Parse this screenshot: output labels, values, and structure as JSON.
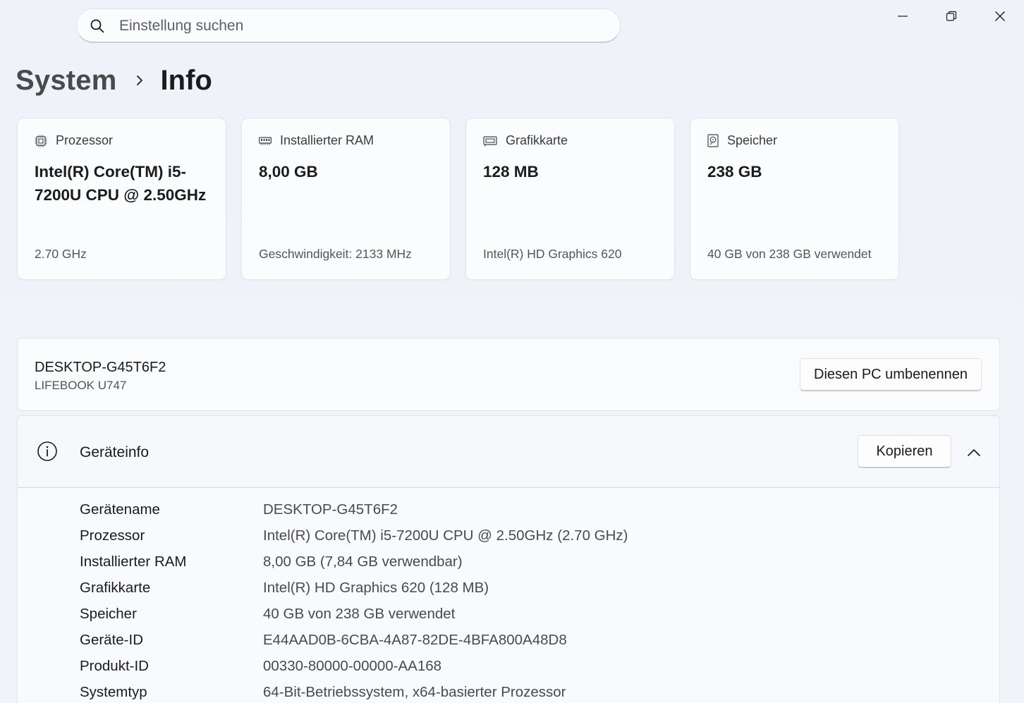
{
  "search": {
    "placeholder": "Einstellung suchen"
  },
  "window_controls": {
    "minimize": "minimize-icon",
    "maximize": "restore-icon",
    "close": "close-icon"
  },
  "breadcrumb": {
    "parent": "System",
    "current": "Info"
  },
  "cards": [
    {
      "icon": "processor-icon",
      "label": "Prozessor",
      "value": "Intel(R) Core(TM) i5-7200U CPU @ 2.50GHz",
      "sub": "2.70 GHz"
    },
    {
      "icon": "ram-icon",
      "label": "Installierter RAM",
      "value": "8,00 GB",
      "sub": "Geschwindigkeit: 2133 MHz"
    },
    {
      "icon": "graphics-card-icon",
      "label": "Grafikkarte",
      "value": "128 MB",
      "sub": "Intel(R) HD Graphics 620"
    },
    {
      "icon": "storage-icon",
      "label": "Speicher",
      "value": "238 GB",
      "sub": "40 GB von 238 GB verwendet"
    }
  ],
  "device": {
    "name": "DESKTOP-G45T6F2",
    "model": "LIFEBOOK U747",
    "rename_button": "Diesen PC umbenennen"
  },
  "device_info": {
    "title": "Geräteinfo",
    "copy_button": "Kopieren",
    "rows": [
      {
        "label": "Gerätename",
        "value": "DESKTOP-G45T6F2"
      },
      {
        "label": "Prozessor",
        "value": "Intel(R) Core(TM) i5-7200U CPU @ 2.50GHz (2.70 GHz)"
      },
      {
        "label": "Installierter RAM",
        "value": "8,00 GB (7,84 GB verwendbar)"
      },
      {
        "label": "Grafikkarte",
        "value": "Intel(R) HD Graphics 620 (128 MB)"
      },
      {
        "label": "Speicher",
        "value": "40 GB von 238 GB verwendet"
      },
      {
        "label": "Geräte-ID",
        "value": "E44AAD0B-6CBA-4A87-82DE-4BFA800A48D8"
      },
      {
        "label": "Produkt-ID",
        "value": "00330-80000-00000-AA168"
      },
      {
        "label": "Systemtyp",
        "value": "64-Bit-Betriebssystem, x64-basierter Prozessor"
      }
    ]
  }
}
